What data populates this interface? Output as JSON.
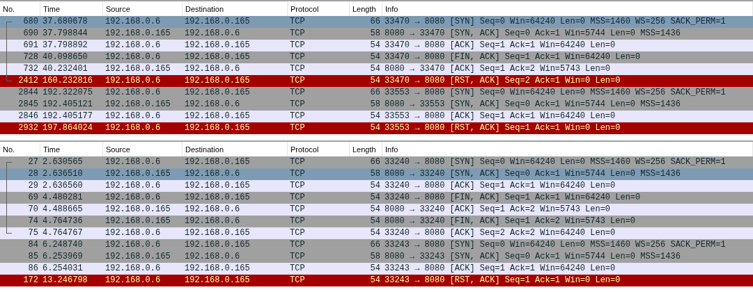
{
  "panes": [
    {
      "columns": [
        "No.",
        "Time",
        "Source",
        "Destination",
        "Protocol",
        "Length",
        "Info"
      ],
      "rows": [
        {
          "selected": true,
          "conversation_start": true,
          "conversation_middle": false,
          "conversation_end": false,
          "cells": [
            "680",
            "37.680678",
            "192.168.0.6",
            "192.168.0.165",
            "TCP",
            "66",
            "33470 → 8080 [SYN] Seq=0 Win=64240 Len=0 MSS=1460 WS=256 SACK_PERM=1"
          ]
        },
        {
          "kind": "grey",
          "selected": false,
          "conversation_start": false,
          "conversation_middle": true,
          "conversation_end": false,
          "cells": [
            "690",
            "37.798844",
            "192.168.0.165",
            "192.168.0.6",
            "TCP",
            "58",
            "8080 → 33470 [SYN, ACK] Seq=0 Ack=1 Win=5744 Len=0 MSS=1436"
          ]
        },
        {
          "kind": "light",
          "selected": false,
          "conversation_start": false,
          "conversation_middle": true,
          "conversation_end": false,
          "cells": [
            "691",
            "37.798892",
            "192.168.0.6",
            "192.168.0.165",
            "TCP",
            "54",
            "33470 → 8080 [ACK] Seq=1 Ack=1 Win=64240 Len=0"
          ]
        },
        {
          "kind": "grey",
          "selected": false,
          "conversation_start": false,
          "conversation_middle": true,
          "conversation_end": false,
          "cells": [
            "728",
            "40.098650",
            "192.168.0.6",
            "192.168.0.165",
            "TCP",
            "54",
            "33470 → 8080 [FIN, ACK] Seq=1 Ack=1 Win=64240 Len=0"
          ]
        },
        {
          "kind": "light",
          "selected": false,
          "conversation_start": false,
          "conversation_middle": true,
          "conversation_end": false,
          "cells": [
            "732",
            "40.232401",
            "192.168.0.165",
            "192.168.0.6",
            "TCP",
            "54",
            "8080 → 33470 [ACK] Seq=1 Ack=2 Win=5743 Len=0"
          ]
        },
        {
          "kind": "reset",
          "selected": false,
          "conversation_start": false,
          "conversation_middle": false,
          "conversation_end": true,
          "cells": [
            "2412",
            "160.232816",
            "192.168.0.6",
            "192.168.0.165",
            "TCP",
            "54",
            "33470 → 8080 [RST, ACK] Seq=2 Ack=1 Win=0 Len=0"
          ]
        },
        {
          "kind": "grey",
          "selected": false,
          "conversation_start": false,
          "conversation_middle": false,
          "conversation_end": false,
          "cells": [
            "2844",
            "192.322075",
            "192.168.0.6",
            "192.168.0.165",
            "TCP",
            "66",
            "33553 → 8080 [SYN] Seq=0 Win=64240 Len=0 MSS=1460 WS=256 SACK_PERM=1"
          ]
        },
        {
          "kind": "grey",
          "selected": false,
          "conversation_start": false,
          "conversation_middle": false,
          "conversation_end": false,
          "cells": [
            "2845",
            "192.405121",
            "192.168.0.165",
            "192.168.0.6",
            "TCP",
            "58",
            "8080 → 33553 [SYN, ACK] Seq=0 Ack=1 Win=5744 Len=0 MSS=1436"
          ]
        },
        {
          "kind": "light",
          "selected": false,
          "conversation_start": false,
          "conversation_middle": false,
          "conversation_end": false,
          "cells": [
            "2846",
            "192.405177",
            "192.168.0.6",
            "192.168.0.165",
            "TCP",
            "54",
            "33553 → 8080 [ACK] Seq=1 Ack=1 Win=64240 Len=0"
          ]
        },
        {
          "kind": "reset",
          "selected": false,
          "conversation_start": false,
          "conversation_middle": false,
          "conversation_end": false,
          "cells": [
            "2932",
            "197.864024",
            "192.168.0.6",
            "192.168.0.165",
            "TCP",
            "54",
            "33553 → 8080 [RST, ACK] Seq=1 Ack=1 Win=0 Len=0"
          ]
        }
      ]
    },
    {
      "columns": [
        "No.",
        "Time",
        "Source",
        "Destination",
        "Protocol",
        "Length",
        "Info"
      ],
      "rows": [
        {
          "kind": "grey",
          "selected": false,
          "conversation_start": true,
          "conversation_middle": false,
          "conversation_end": false,
          "cells": [
            "27",
            "2.630565",
            "192.168.0.6",
            "192.168.0.165",
            "TCP",
            "66",
            "33240 → 8080 [SYN] Seq=0 Win=64240 Len=0 MSS=1460 WS=256 SACK_PERM=1"
          ]
        },
        {
          "selected": true,
          "conversation_start": false,
          "conversation_middle": true,
          "conversation_end": false,
          "cells": [
            "28",
            "2.636510",
            "192.168.0.165",
            "192.168.0.6",
            "TCP",
            "58",
            "8080 → 33240 [SYN, ACK] Seq=0 Ack=1 Win=5744 Len=0 MSS=1436"
          ]
        },
        {
          "kind": "light",
          "selected": false,
          "conversation_start": false,
          "conversation_middle": true,
          "conversation_end": false,
          "cells": [
            "29",
            "2.636560",
            "192.168.0.6",
            "192.168.0.165",
            "TCP",
            "54",
            "33240 → 8080 [ACK] Seq=1 Ack=1 Win=64240 Len=0"
          ]
        },
        {
          "kind": "grey",
          "selected": false,
          "conversation_start": false,
          "conversation_middle": true,
          "conversation_end": false,
          "cells": [
            "69",
            "4.480281",
            "192.168.0.6",
            "192.168.0.165",
            "TCP",
            "54",
            "33240 → 8080 [FIN, ACK] Seq=1 Ack=1 Win=64240 Len=0"
          ]
        },
        {
          "kind": "light",
          "selected": false,
          "conversation_start": false,
          "conversation_middle": true,
          "conversation_end": false,
          "cells": [
            "70",
            "4.488665",
            "192.168.0.165",
            "192.168.0.6",
            "TCP",
            "54",
            "8080 → 33240 [ACK] Seq=1 Ack=2 Win=5743 Len=0"
          ]
        },
        {
          "kind": "grey",
          "selected": false,
          "conversation_start": false,
          "conversation_middle": true,
          "conversation_end": false,
          "cells": [
            "74",
            "4.764736",
            "192.168.0.165",
            "192.168.0.6",
            "TCP",
            "54",
            "8080 → 33240 [FIN, ACK] Seq=1 Ack=2 Win=5743 Len=0"
          ]
        },
        {
          "kind": "light",
          "selected": false,
          "conversation_start": false,
          "conversation_middle": false,
          "conversation_end": true,
          "cells": [
            "75",
            "4.764767",
            "192.168.0.6",
            "192.168.0.165",
            "TCP",
            "54",
            "33240 → 8080 [ACK] Seq=2 Ack=2 Win=64240 Len=0"
          ]
        },
        {
          "kind": "grey",
          "selected": false,
          "conversation_start": false,
          "conversation_middle": false,
          "conversation_end": false,
          "cells": [
            "84",
            "6.248740",
            "192.168.0.6",
            "192.168.0.165",
            "TCP",
            "66",
            "33243 → 8080 [SYN] Seq=0 Win=64240 Len=0 MSS=1460 WS=256 SACK_PERM=1"
          ]
        },
        {
          "kind": "grey",
          "selected": false,
          "conversation_start": false,
          "conversation_middle": false,
          "conversation_end": false,
          "cells": [
            "85",
            "6.253969",
            "192.168.0.165",
            "192.168.0.6",
            "TCP",
            "58",
            "8080 → 33243 [SYN, ACK] Seq=0 Ack=1 Win=5744 Len=0 MSS=1436"
          ]
        },
        {
          "kind": "light",
          "selected": false,
          "conversation_start": false,
          "conversation_middle": false,
          "conversation_end": false,
          "cells": [
            "86",
            "6.254031",
            "192.168.0.6",
            "192.168.0.165",
            "TCP",
            "54",
            "33243 → 8080 [ACK] Seq=1 Ack=1 Win=64240 Len=0"
          ]
        },
        {
          "kind": "reset",
          "selected": false,
          "conversation_start": false,
          "conversation_middle": false,
          "conversation_end": false,
          "cells": [
            "172",
            "13.246798",
            "192.168.0.6",
            "192.168.0.165",
            "TCP",
            "54",
            "33243 → 8080 [RST, ACK] Seq=1 Ack=1 Win=0 Len=0"
          ]
        }
      ]
    }
  ]
}
